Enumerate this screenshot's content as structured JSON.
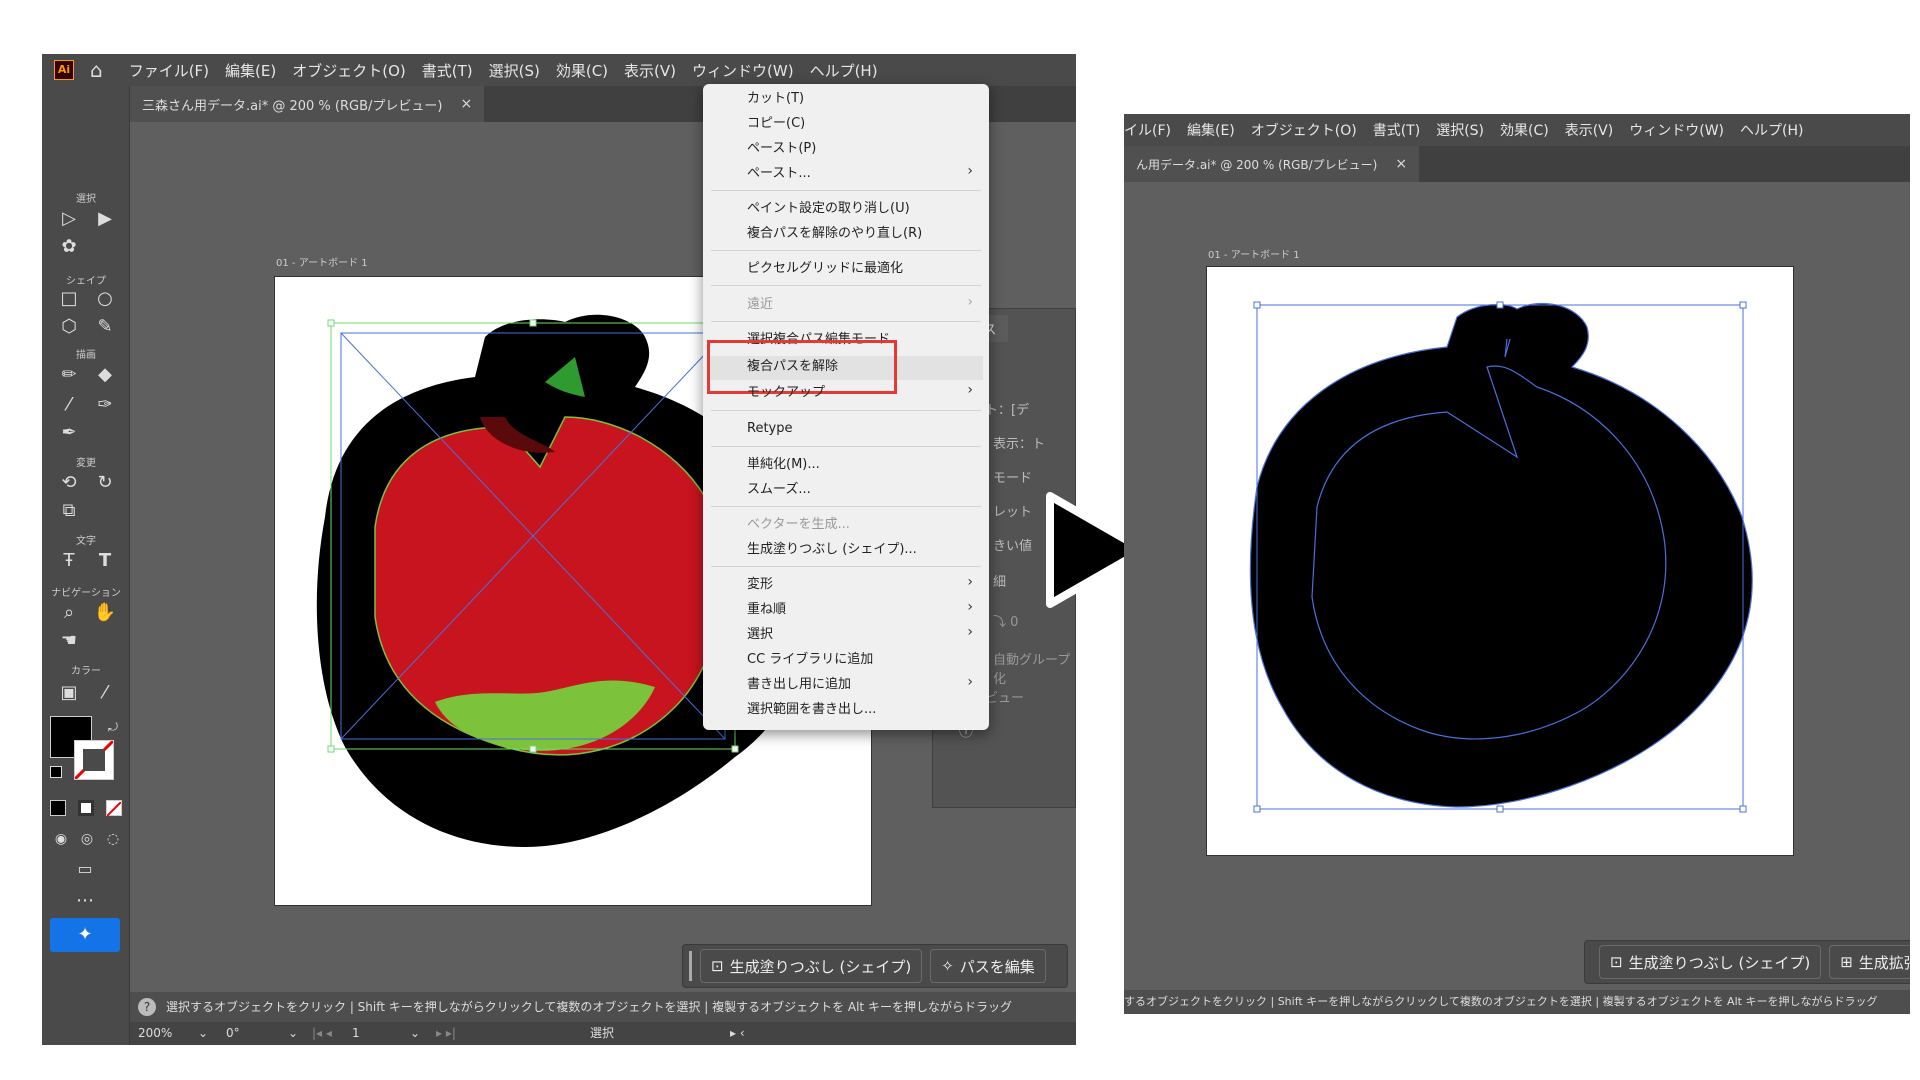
{
  "menus": [
    "ファイル(F)",
    "編集(E)",
    "オブジェクト(O)",
    "書式(T)",
    "選択(S)",
    "効果(C)",
    "表示(V)",
    "ウィンドウ(W)",
    "ヘルプ(H)"
  ],
  "right_menus": [
    "イル(F)",
    "編集(E)",
    "オブジェクト(O)",
    "書式(T)",
    "選択(S)",
    "効果(C)",
    "表示(V)",
    "ウィンドウ(W)",
    "ヘルプ(H)"
  ],
  "app_logo": "Ai",
  "doc_tab": "三森さん用データ.ai* @ 200 % (RGB/プレビュー)",
  "doc_tab_right": "ん用データ.ai* @ 200 % (RGB/プレビュー)",
  "tab_close": "×",
  "artboard_label": "01 - アートボード 1",
  "tool_groups": [
    "選択",
    "シェイプ",
    "描画",
    "変更",
    "文字",
    "ナビゲーション",
    "カラー"
  ],
  "context_menu": [
    {
      "label": "カット(T)",
      "disabled": false,
      "sub": false
    },
    {
      "label": "コピー(C)",
      "disabled": false,
      "sub": false
    },
    {
      "label": "ペースト(P)",
      "disabled": false,
      "sub": false
    },
    {
      "label": "ペースト...",
      "disabled": false,
      "sub": true
    },
    {
      "label": "ペイント設定の取り消し(U)",
      "disabled": false,
      "sub": false
    },
    {
      "label": "複合パスを解除のやり直し(R)",
      "disabled": false,
      "sub": false
    },
    {
      "label": "ピクセルグリッドに最適化",
      "disabled": false,
      "sub": false
    },
    {
      "label": "遠近",
      "disabled": true,
      "sub": true
    },
    {
      "label": "選択複合パス編集モード",
      "disabled": false,
      "sub": false
    },
    {
      "label": "複合パスを解除",
      "disabled": false,
      "sub": false
    },
    {
      "label": "モックアップ",
      "disabled": false,
      "sub": true
    },
    {
      "label": "Retype",
      "disabled": false,
      "sub": false
    },
    {
      "label": "単純化(M)...",
      "disabled": false,
      "sub": false
    },
    {
      "label": "スムーズ...",
      "disabled": false,
      "sub": false
    },
    {
      "label": "ベクターを生成...",
      "disabled": true,
      "sub": false
    },
    {
      "label": "生成塗りつぶし (シェイプ)...",
      "disabled": false,
      "sub": false
    },
    {
      "label": "変形",
      "disabled": false,
      "sub": true
    },
    {
      "label": "重ね順",
      "disabled": false,
      "sub": true
    },
    {
      "label": "選択",
      "disabled": false,
      "sub": true
    },
    {
      "label": "CC ライブラリに追加",
      "disabled": false,
      "sub": false
    },
    {
      "label": "書き出し用に追加",
      "disabled": false,
      "sub": true
    },
    {
      "label": "選択範囲を書き出し...",
      "disabled": false,
      "sub": false
    }
  ],
  "sub_arrow": "›",
  "panel_behind": [
    "ース",
    "セット：[デ",
    "表示：ト",
    "モード",
    "レット",
    "きい値",
    "細",
    "  ⤵ 0",
    "自動グループ化",
    "プレビュー"
  ],
  "ctxbar": {
    "fill_shape": "生成塗りつぶし (シェイプ)",
    "edit_path": "パスを編集",
    "fill_ext": "生成拡張"
  },
  "status_text": "選択するオブジェクトをクリック | Shift キーを押しながらクリックして複数のオブジェクトを選択 | 複製するオブジェクトを Alt キーを押しながらドラッグ",
  "status_text_right": "するオブジェクトをクリック | Shift キーを押しながらクリックして複数のオブジェクトを選択 | 複製するオブジェクトを Alt キーを押しながらドラッグ",
  "bottom": {
    "zoom": "200%",
    "angle": "0°",
    "page": "1",
    "mode": "選択"
  },
  "colors": {
    "highlight": "#e53935",
    "selection_blue": "#4a6fdc",
    "selection_green": "#6ddb6d",
    "apple_red": "#c8141e",
    "apple_green": "#7cc23a"
  }
}
